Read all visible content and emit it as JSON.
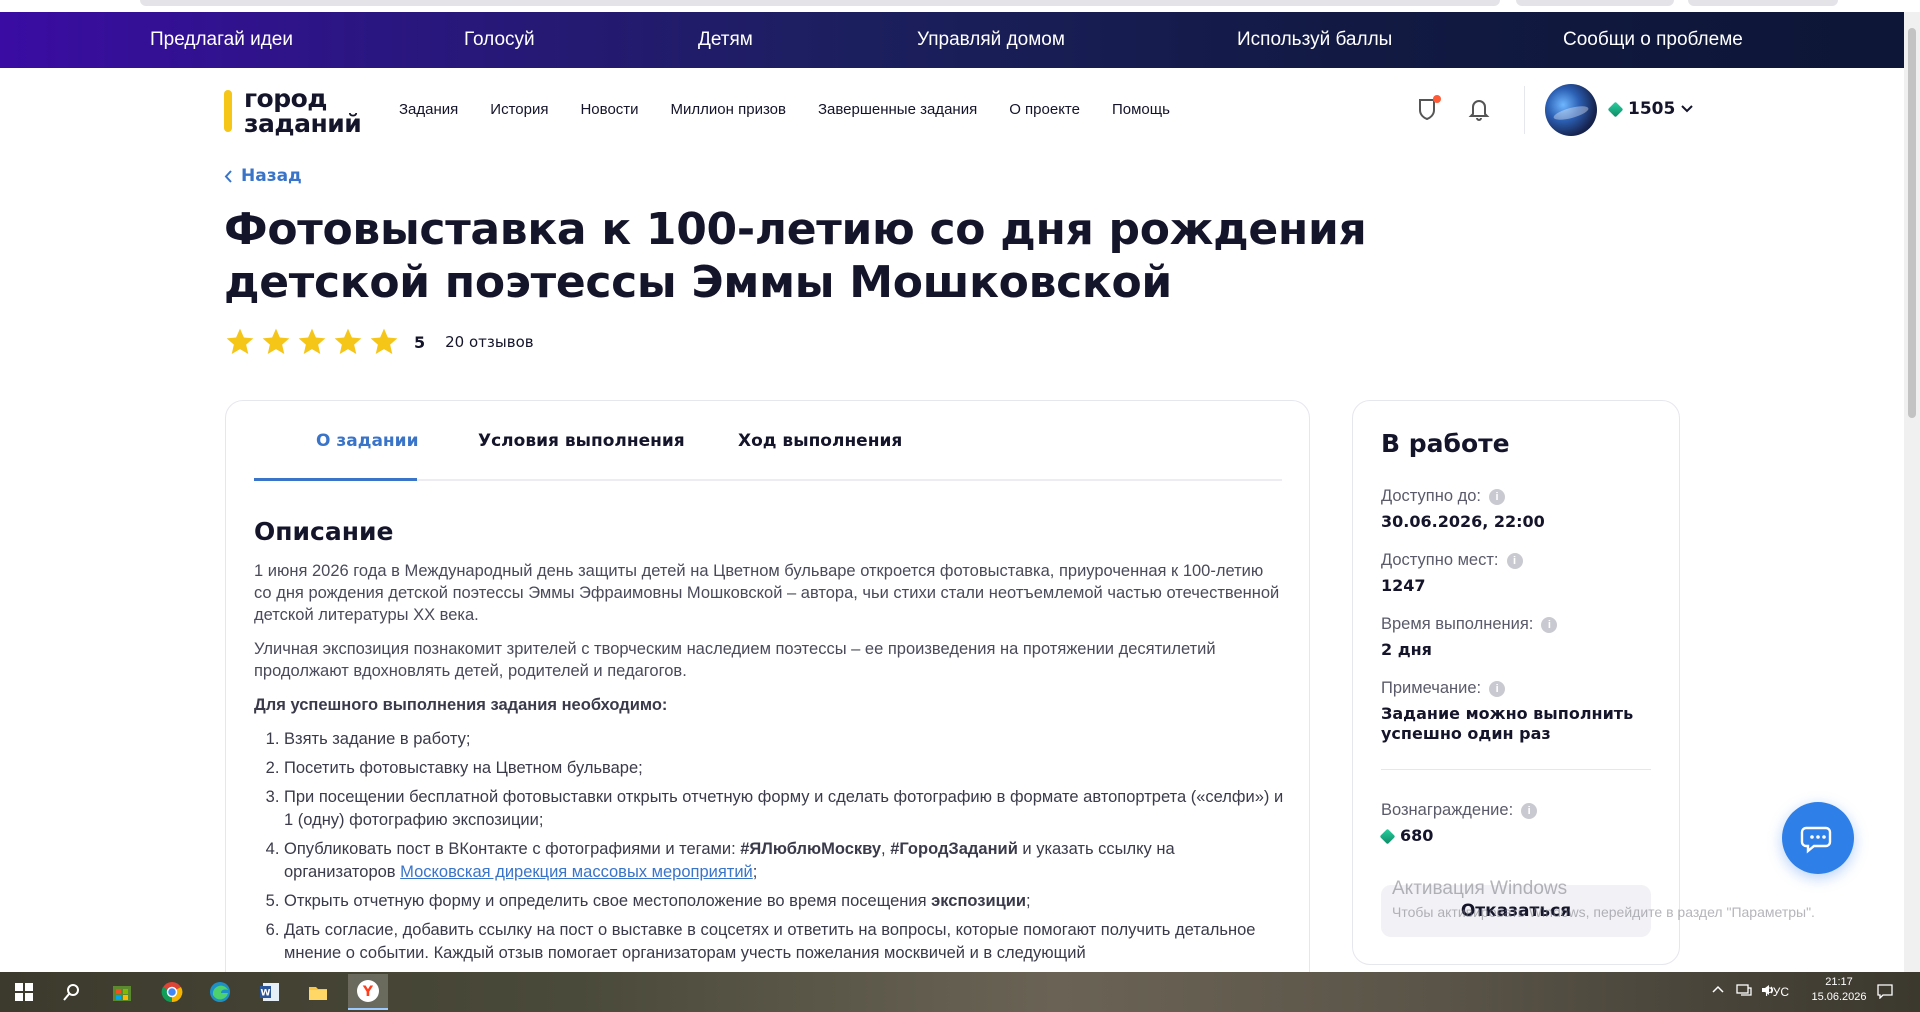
{
  "promo_bar": {
    "items": [
      "Предлагай идеи",
      "Голосуй",
      "Детям",
      "Управляй домом",
      "Используй баллы",
      "Сообщи о проблеме"
    ]
  },
  "header": {
    "logo_line1": "город",
    "logo_line2": "заданий",
    "nav": [
      "Задания",
      "История",
      "Новости",
      "Миллион призов",
      "Завершенные задания",
      "О проекте",
      "Помощь"
    ],
    "points": "1505"
  },
  "back_label": "Назад",
  "title": "Фотовыставка к 100-летию со дня рождения детской поэтессы Эммы Мошковской",
  "rating": {
    "stars": 5,
    "value": "5",
    "reviews": "20 отзывов"
  },
  "tabs": [
    "О задании",
    "Условия выполнения",
    "Ход выполнения"
  ],
  "description": {
    "heading": "Описание",
    "p1": "1 июня 2026 года в Международный день защиты детей на Цветном бульваре откроется фотовыставка, приуроченная к 100-летию со дня рождения детской поэтессы Эммы Эфраимовны Мошковской – автора, чьи стихи стали неотъемлемой частью отечественной детской литературы XX века.",
    "p2": "Уличная экспозиция познакомит зрителей с творческим наследием поэтессы – ее произведения на протяжении десятилетий продолжают вдохновлять детей, родителей и педагогов.",
    "p3": "Для успешного выполнения задания необходимо:",
    "steps": {
      "s1": "Взять задание в работу;",
      "s2": "Посетить фотовыставку на Цветном бульваре;",
      "s3": "При посещении бесплатной фотовыставки открыть отчетную форму и сделать фотографию в формате автопортрета («селфи») и 1 (одну) фотографию экспозиции;",
      "s4_a": "Опубликовать пост в ВКонтакте с фотографиями и тегами: ",
      "s4_tag1": "#ЯЛюблюМоскву",
      "s4_sep": ", ",
      "s4_tag2": "#ГородЗаданий",
      "s4_b": " и указать ссылку на организаторов ",
      "s4_link": "Московская дирекция массовых мероприятий",
      "s4_end": ";",
      "s5_a": "Открыть отчетную форму и определить свое местоположение во время посещения ",
      "s5_b": "экспозиции",
      "s5_end": ";",
      "s6": "Дать согласие, добавить ссылку на пост о выставке в соцсетях и ответить на вопросы, которые помогают получить детальное мнение о событии. Каждый отзыв помогает организаторам учесть пожелания москвичей и в следующий"
    }
  },
  "side": {
    "status": "В работе",
    "available_until_label": "Доступно до:",
    "available_until": "30.06.2026, 22:00",
    "places_label": "Доступно мест:",
    "places": "1247",
    "duration_label": "Время выполнения:",
    "duration": "2 дня",
    "note_label": "Примечание:",
    "note": "Задание можно выполнить успешно один раз",
    "reward_label": "Вознаграждение:",
    "reward": "680",
    "refuse_button": "Отказаться"
  },
  "watermark": {
    "line1": "Активация Windows",
    "line2": "Чтобы активировать Windows, перейдите в раздел \"Параметры\"."
  },
  "taskbar": {
    "lang": "РУС",
    "time": "21:17",
    "date": "15.06.2026"
  },
  "colors": {
    "accent": "#3a74c9",
    "star": "#f5c518",
    "gem": "#1fb88a",
    "promo_start": "#3a0ca3",
    "promo_end": "#0d1636"
  }
}
